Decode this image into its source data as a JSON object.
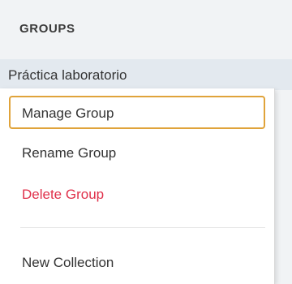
{
  "sidebar": {
    "section_title": "GROUPS",
    "group_name": "Práctica laboratorio"
  },
  "menu": {
    "items": [
      {
        "label": "Manage Group"
      },
      {
        "label": "Rename Group"
      },
      {
        "label": "Delete Group"
      },
      {
        "label": "New Collection"
      }
    ],
    "focus_color": "#e0a33a",
    "danger_color": "#e0304a"
  }
}
